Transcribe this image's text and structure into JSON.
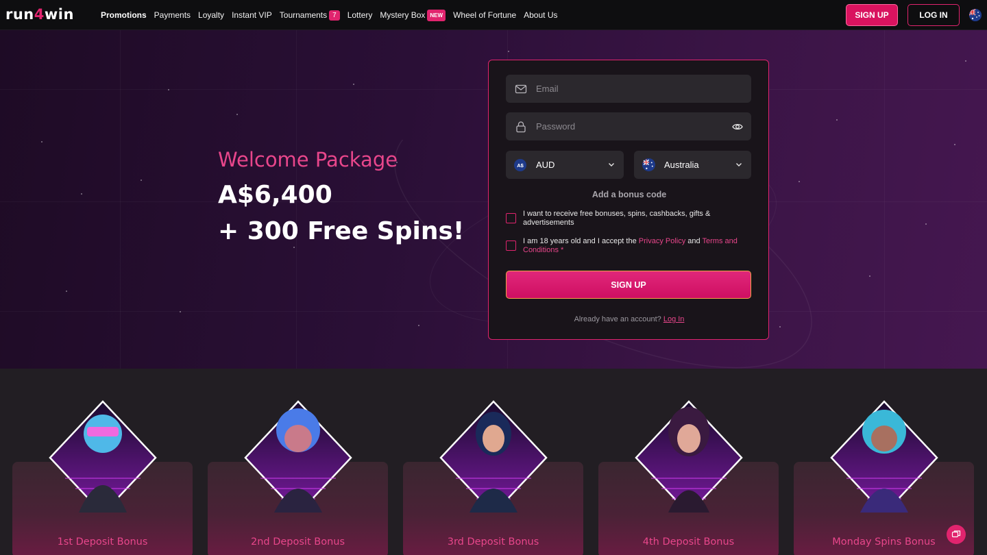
{
  "brand": {
    "logo_pre": "run",
    "logo_accent": "4",
    "logo_post": "win"
  },
  "nav": [
    {
      "label": "Promotions",
      "active": true
    },
    {
      "label": "Payments"
    },
    {
      "label": "Loyalty"
    },
    {
      "label": "Instant VIP"
    },
    {
      "label": "Tournaments",
      "badge": "7"
    },
    {
      "label": "Lottery"
    },
    {
      "label": "Mystery Box",
      "badge": "NEW"
    },
    {
      "label": "Wheel of Fortune"
    },
    {
      "label": "About Us"
    }
  ],
  "header": {
    "signup_label": "SIGN UP",
    "login_label": "LOG IN",
    "language_icon": "australia-flag-icon"
  },
  "hero": {
    "title": "Welcome Package",
    "amount": "A$6,400",
    "spins": "+ 300 Free Spins!"
  },
  "form": {
    "email_placeholder": "Email",
    "password_placeholder": "Password",
    "currency_value": "AUD",
    "currency_icon_text": "A$",
    "country_value": "Australia",
    "bonus_code_label": "Add a bonus code",
    "consent_marketing": "I want to receive free bonuses, spins, cashbacks, gifts & advertisements",
    "consent_age_pre": "I am 18 years old and I accept the ",
    "consent_privacy": "Privacy Policy",
    "consent_and": " and ",
    "consent_terms": "Terms and Conditions",
    "consent_required": " *",
    "signup_button": "SIGN UP",
    "already_text": "Already have an account? ",
    "login_link": "Log In"
  },
  "bonus_cards": [
    {
      "label": "1st Deposit Bonus"
    },
    {
      "label": "2nd Deposit Bonus"
    },
    {
      "label": "3rd Deposit Bonus"
    },
    {
      "label": "4th Deposit Bonus"
    },
    {
      "label": "Monday Spins Bonus"
    }
  ],
  "colors": {
    "accent": "#e1246e",
    "accent_text": "#e8468b",
    "hero_bg": "#2a0f36",
    "card_bg": "#19141a"
  }
}
